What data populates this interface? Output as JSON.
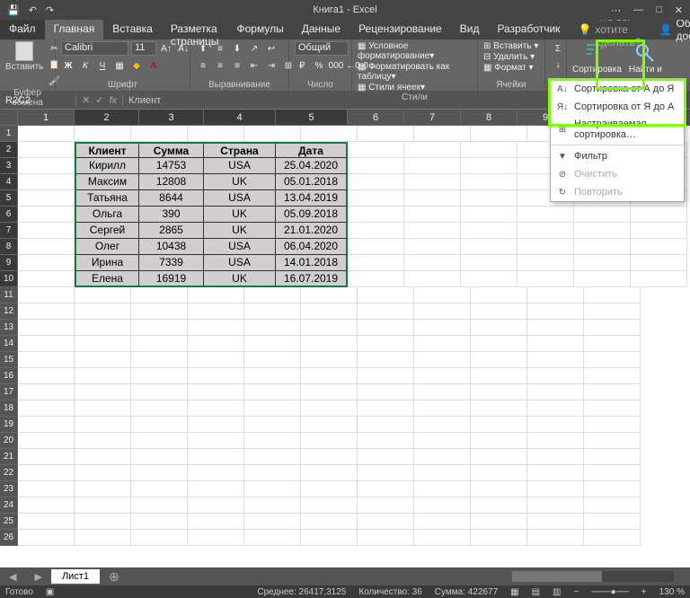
{
  "title": "Книга1 - Excel",
  "qat": {
    "save": "💾",
    "undo": "↶",
    "redo": "↷"
  },
  "tabs": {
    "file": "Файл",
    "items": [
      "Главная",
      "Вставка",
      "Разметка страницы",
      "Формулы",
      "Данные",
      "Рецензирование",
      "Вид",
      "Разработчик"
    ],
    "active": "Главная",
    "tell_me": "Что вы хотите сделать?",
    "share": "Общий доступ"
  },
  "ribbon": {
    "clipboard": {
      "paste": "Вставить",
      "label": "Буфер обмена"
    },
    "font": {
      "name": "Calibri",
      "size": "11",
      "label": "Шрифт"
    },
    "alignment": {
      "label": "Выравнивание"
    },
    "number": {
      "format": "Общий",
      "label": "Число"
    },
    "styles": {
      "cond": "Условное форматирование",
      "table": "Форматировать как таблицу",
      "cell": "Стили ячеек",
      "label": "Стили"
    },
    "cells": {
      "insert": "Вставить",
      "delete": "Удалить",
      "format": "Формат",
      "label": "Ячейки"
    },
    "editing": {
      "sort": "Сортировка",
      "find": "Найти и"
    }
  },
  "name_box": "R2C2",
  "formula": "Клиент",
  "columns": [
    "1",
    "2",
    "3",
    "4",
    "5",
    "6",
    "7",
    "8",
    "9"
  ],
  "table": {
    "headers": [
      "Клиент",
      "Сумма",
      "Страна",
      "Дата"
    ],
    "rows": [
      [
        "Кирилл",
        "14753",
        "USA",
        "25.04.2020"
      ],
      [
        "Максим",
        "12808",
        "UK",
        "05.01.2018"
      ],
      [
        "Татьяна",
        "8644",
        "USA",
        "13.04.2019"
      ],
      [
        "Ольга",
        "390",
        "UK",
        "05.09.2018"
      ],
      [
        "Сергей",
        "2865",
        "UK",
        "21.01.2020"
      ],
      [
        "Олег",
        "10438",
        "USA",
        "06.04.2020"
      ],
      [
        "Ирина",
        "7339",
        "USA",
        "14.01.2018"
      ],
      [
        "Елена",
        "16919",
        "UK",
        "16.07.2019"
      ]
    ]
  },
  "dropdown": {
    "sort_asc": "Сортировка от А до Я",
    "sort_desc": "Сортировка от Я до А",
    "custom_sort": "Настраиваемая сортировка…",
    "filter": "Фильтр",
    "clear": "Очистить",
    "reapply": "Повторить"
  },
  "sheet": {
    "name": "Лист1"
  },
  "status": {
    "ready": "Готово",
    "avg": "Среднее: 26417,3125",
    "count": "Количество: 36",
    "sum": "Сумма: 422677",
    "zoom": "130 %"
  }
}
